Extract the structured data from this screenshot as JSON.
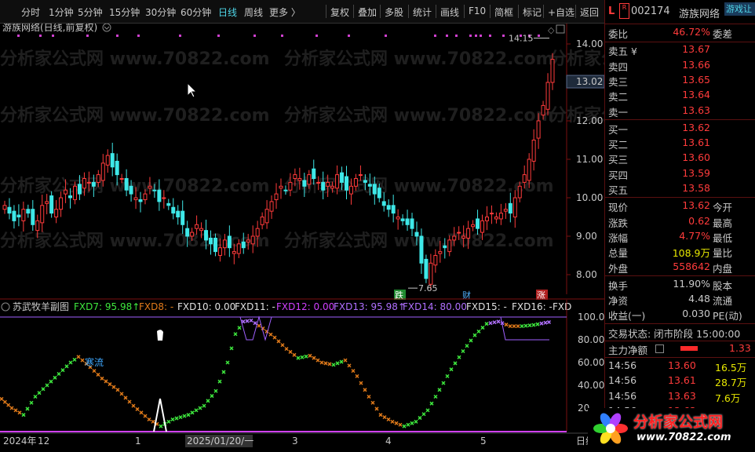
{
  "toolbar": {
    "periods": [
      "分时",
      "1分钟",
      "5分钟",
      "15分钟",
      "30分钟",
      "60分钟",
      "日线",
      "周线",
      "更多 〉"
    ],
    "active_period": "日线",
    "tools": [
      "复权",
      "叠加",
      "多股",
      "统计",
      "画线",
      "F10",
      "简框",
      "标记",
      "+自选",
      "返回"
    ]
  },
  "chart": {
    "title": "游族网络(日线,前复权)",
    "price_axis": [
      "14.00",
      "13.00",
      "12.00",
      "11.00",
      "10.00",
      "9.00",
      "8.00"
    ],
    "current_price_tag": "13.02",
    "high_label": "14.15",
    "low_label": "7.65",
    "marker_die": "跌",
    "marker_cai": "财",
    "marker_zhang": "涨",
    "watermark": "分析家公式网 www.70822.com"
  },
  "indicator": {
    "name": "苏武牧羊副图",
    "legend": [
      {
        "text": "FXD7: 95.98↑",
        "color": "#3ee83e"
      },
      {
        "text": "FXD8: -",
        "color": "#e07a1a"
      },
      {
        "text": "FXD10: 0.00",
        "color": "#e0e0e0"
      },
      {
        "text": "FXD11: -",
        "color": "#e0e0e0"
      },
      {
        "text": "FXD12: 0.00",
        "color": "#d040ff"
      },
      {
        "text": "FXD13: 95.98↑",
        "color": "#b070ff"
      },
      {
        "text": "FXD14: 80.00",
        "color": "#b070ff"
      },
      {
        "text": "FXD15: -",
        "color": "#e0e0e0"
      },
      {
        "text": "FXD16: -",
        "color": "#e0e0e0"
      },
      {
        "text": "FXD",
        "color": "#e0e0e0"
      }
    ],
    "axis": [
      "100.0",
      "80.00",
      "60.00",
      "40.00",
      "20."
    ],
    "annotation": "寒流"
  },
  "date_axis": {
    "labels": [
      "2024年",
      "12",
      "1",
      "2025/01/20/一",
      "3",
      "4",
      "5"
    ],
    "right_label": "日线"
  },
  "quote": {
    "code_prefix": "L",
    "code": "002174",
    "name": "游族网络",
    "badge": "游戏让",
    "weibi_label": "委比",
    "weibi_value": "46.72%",
    "weicha_label": "委差",
    "asks": [
      {
        "label": "卖五 ¥",
        "price": "13.67"
      },
      {
        "label": "卖四",
        "price": "13.66"
      },
      {
        "label": "卖三",
        "price": "13.65"
      },
      {
        "label": "卖二",
        "price": "13.64"
      },
      {
        "label": "卖一",
        "price": "13.63"
      }
    ],
    "bids": [
      {
        "label": "买一",
        "price": "13.62"
      },
      {
        "label": "买二",
        "price": "13.61"
      },
      {
        "label": "买三",
        "price": "13.60"
      },
      {
        "label": "买四",
        "price": "13.59"
      },
      {
        "label": "买五",
        "price": "13.58"
      }
    ],
    "stats": [
      {
        "label": "现价",
        "value": "13.62",
        "label2": "今开",
        "color": "#ff3b3b"
      },
      {
        "label": "涨跌",
        "value": "0.62",
        "label2": "最高",
        "color": "#ff3b3b"
      },
      {
        "label": "涨幅",
        "value": "4.77%",
        "label2": "最低",
        "color": "#ff3b3b"
      },
      {
        "label": "总量",
        "value": "108.9万",
        "label2": "量比",
        "color": "#e8e800"
      },
      {
        "label": "外盘",
        "value": "558642",
        "label2": "内盘",
        "color": "#ff3b3b"
      }
    ],
    "stats2": [
      {
        "label": "换手",
        "value": "11.90%",
        "label2": "股本",
        "color": "#c8c8c8"
      },
      {
        "label": "净资",
        "value": "4.48",
        "label2": "流通",
        "color": "#c8c8c8"
      },
      {
        "label": "收益(一)",
        "value": "0.030",
        "label2": "PE(动)",
        "color": "#c8c8c8"
      }
    ],
    "trade_status": "交易状态: 闭市阶段 15:00:00",
    "main_net_label": "主力净额",
    "main_net_value": "1.33",
    "ticks": [
      {
        "time": "14:56",
        "price": "13.60",
        "vol": "16.5万"
      },
      {
        "time": "14:56",
        "price": "13.61",
        "vol": "28.7万"
      },
      {
        "time": "14:56",
        "price": "13.63",
        "vol": "7.6万"
      },
      {
        "time": "14:56",
        "price": "13.63",
        "vol": "10.5万"
      }
    ]
  },
  "logo": {
    "text": "分析家公式网",
    "url": "www.70822.com"
  },
  "colors": {
    "up": "#ff3b3b",
    "down": "#3ee8e8",
    "accent": "#4fd6e8"
  }
}
